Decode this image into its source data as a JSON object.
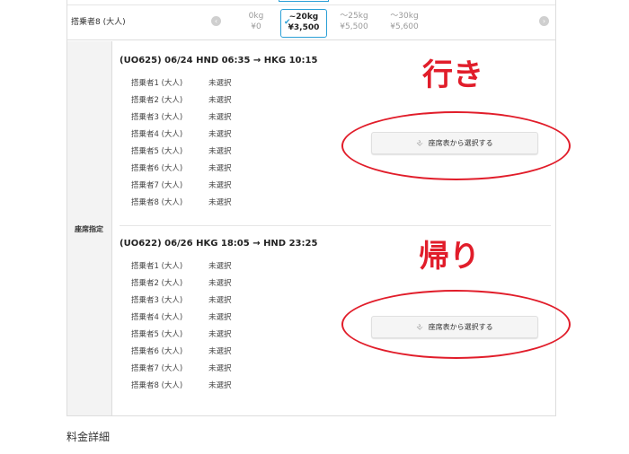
{
  "baggage": {
    "passenger_label": "搭乗者8 (大人)",
    "prev_icon": "chevron-left-icon",
    "next_icon": "chevron-right-icon",
    "options": [
      {
        "weight": "0kg",
        "price": "¥0",
        "selected": false
      },
      {
        "weight": "~20kg",
        "price": "¥3,500",
        "selected": true
      },
      {
        "weight": "～25kg",
        "price": "¥5,500",
        "selected": false
      },
      {
        "weight": "～30kg",
        "price": "¥5,600",
        "selected": false
      }
    ]
  },
  "seat_section": {
    "label": "座席指定",
    "outbound": {
      "title": "(UO625) 06/24  HND 06:35 → HKG 10:15",
      "passengers": [
        {
          "name": "搭乗者1 (大人)",
          "status": "未選択"
        },
        {
          "name": "搭乗者2 (大人)",
          "status": "未選択"
        },
        {
          "name": "搭乗者3 (大人)",
          "status": "未選択"
        },
        {
          "name": "搭乗者4 (大人)",
          "status": "未選択"
        },
        {
          "name": "搭乗者5 (大人)",
          "status": "未選択"
        },
        {
          "name": "搭乗者6 (大人)",
          "status": "未選択"
        },
        {
          "name": "搭乗者7 (大人)",
          "status": "未選択"
        },
        {
          "name": "搭乗者8 (大人)",
          "status": "未選択"
        }
      ],
      "button_label": "座席表から選択する",
      "annotation": "行き"
    },
    "return": {
      "title": "(UO622) 06/26  HKG 18:05 → HND 23:25",
      "passengers": [
        {
          "name": "搭乗者1 (大人)",
          "status": "未選択"
        },
        {
          "name": "搭乗者2 (大人)",
          "status": "未選択"
        },
        {
          "name": "搭乗者3 (大人)",
          "status": "未選択"
        },
        {
          "name": "搭乗者4 (大人)",
          "status": "未選択"
        },
        {
          "name": "搭乗者5 (大人)",
          "status": "未選択"
        },
        {
          "name": "搭乗者6 (大人)",
          "status": "未選択"
        },
        {
          "name": "搭乗者7 (大人)",
          "status": "未選択"
        },
        {
          "name": "搭乗者8 (大人)",
          "status": "未選択"
        }
      ],
      "button_label": "座席表から選択する",
      "annotation": "帰り"
    },
    "seat_icon": "seat-icon"
  },
  "fare_details": {
    "title": "料金詳細"
  },
  "colors": {
    "accent": "#2a9fd6",
    "annotation_red": "#e11d2a"
  }
}
